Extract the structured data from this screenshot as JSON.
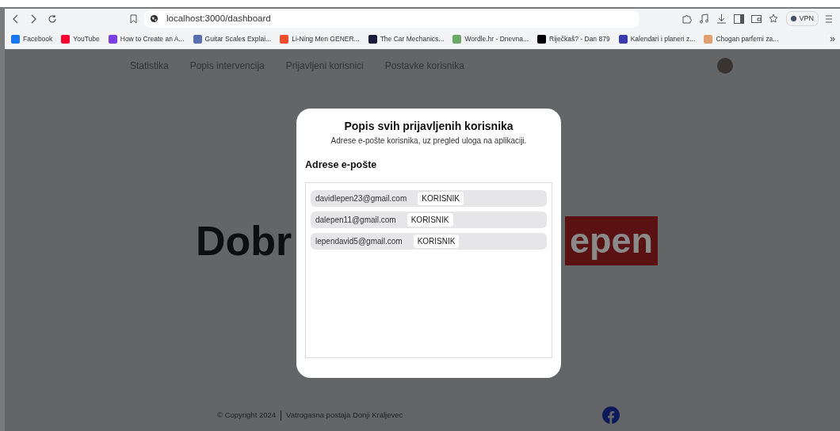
{
  "browser": {
    "url": "localhost:3000/dashboard",
    "vpn_label": "VPN",
    "overflow": "»",
    "bookmarks": [
      {
        "label": "Facebook",
        "color": "#1877f2"
      },
      {
        "label": "YouTube",
        "color": "#ff0033"
      },
      {
        "label": "How to Create an A...",
        "color": "#7b3fe4"
      },
      {
        "label": "Guitar Scales Explai...",
        "color": "#5a6fb0"
      },
      {
        "label": "Li-Ning Men GENER...",
        "color": "#ee4d2d"
      },
      {
        "label": "The Car Mechanics...",
        "color": "#1c1c3c"
      },
      {
        "label": "Wordle.hr - Dnevna...",
        "color": "#6aaa64"
      },
      {
        "label": "Riječkaš? - Dan 879",
        "color": "#000000"
      },
      {
        "label": "Kalendari i planeri z...",
        "color": "#3b3bb0"
      },
      {
        "label": "Chogan parfemi za...",
        "color": "#e0a070"
      }
    ]
  },
  "page": {
    "nav": [
      "Statistika",
      "Popis intervencija",
      "Prijavljeni korisnici",
      "Postavke korisnika"
    ],
    "heading": {
      "left": "Dobr",
      "right": "epen"
    },
    "footer": {
      "copyright": "© Copyright 2024",
      "organization": "Vatrogasna postaja Donji Kraljevec"
    }
  },
  "modal": {
    "title": "Popis svih prijavljenih korisnika",
    "subtitle": "Adrese e-pošte korisnika, uz pregled uloga na aplikaciji.",
    "section_title": "Adrese e-pošte",
    "users": [
      {
        "email": "davidlepen23@gmail.com",
        "role": "KORISNIK"
      },
      {
        "email": "dalepen11@gmail.com",
        "role": "KORISNIK"
      },
      {
        "email": "lependavid5@gmail.com",
        "role": "KORISNIK"
      }
    ]
  }
}
